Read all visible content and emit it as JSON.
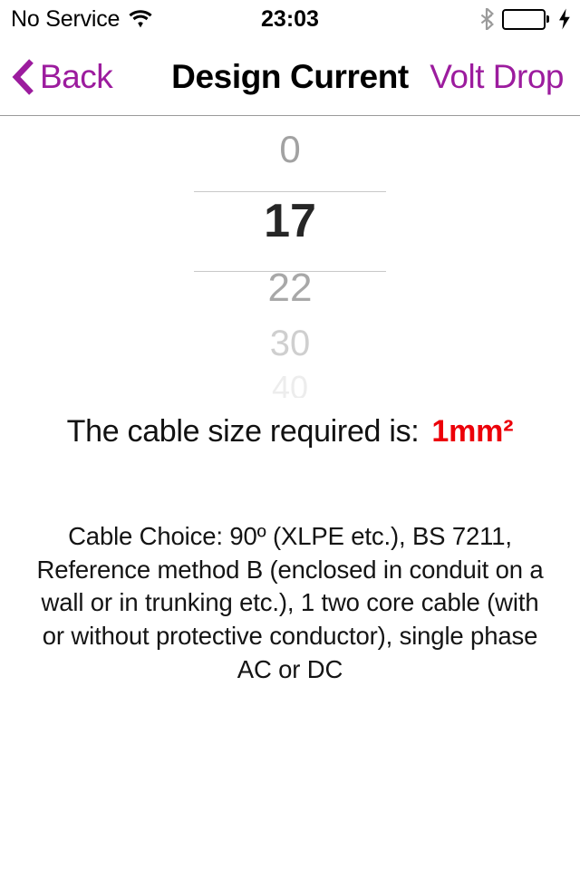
{
  "status_bar": {
    "carrier": "No Service",
    "wifi_icon": "wifi-icon",
    "time": "23:03",
    "bluetooth_icon": "bluetooth-icon",
    "battery_icon": "battery-full-icon",
    "charging_icon": "lightning-bolt-icon",
    "battery_color": "#4CD862"
  },
  "nav_bar": {
    "back_icon": "chevron-left-icon",
    "back_label": "Back",
    "title": "Design Current",
    "right_label": "Volt Drop",
    "tint_color": "#9C1C9E"
  },
  "picker": {
    "name": "design-current-picker",
    "selected_value": "17",
    "rows": [
      {
        "value": "0",
        "state": "above"
      },
      {
        "value": "17",
        "state": "selected"
      },
      {
        "value": "22",
        "state": "below"
      },
      {
        "value": "30",
        "state": "below-faded"
      },
      {
        "value": "40",
        "state": "below-faded-2"
      }
    ]
  },
  "result": {
    "label": "The cable size required is:",
    "value": "1mm²",
    "value_color": "#EC0009"
  },
  "description": {
    "text": "Cable Choice: 90º (XLPE etc.), BS 7211, Reference method B (enclosed in conduit on a wall or in trunking etc.), 1 two core cable (with or without protective conductor), single phase AC or DC"
  }
}
